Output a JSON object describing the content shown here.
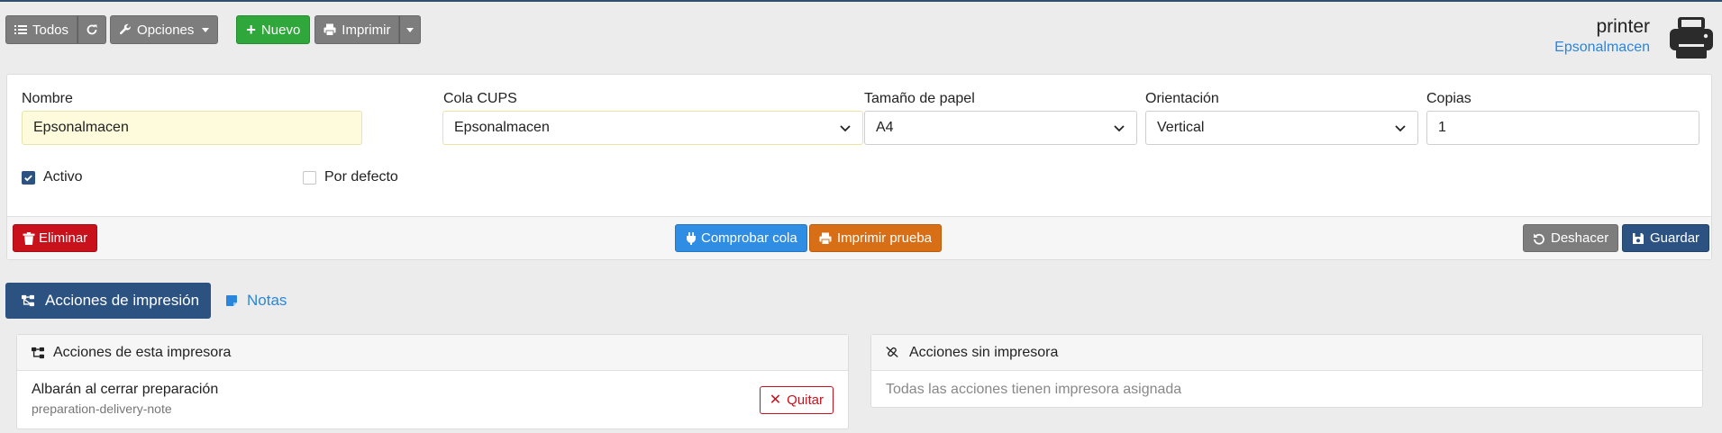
{
  "toolbar": {
    "all_label": "Todos",
    "options_label": "Opciones",
    "new_label": "Nuevo",
    "print_label": "Imprimir"
  },
  "header": {
    "title": "printer",
    "subtitle": "Epsonalmacen"
  },
  "form": {
    "name": {
      "label": "Nombre",
      "value": "Epsonalmacen"
    },
    "cups_queue": {
      "label": "Cola CUPS",
      "value": "Epsonalmacen"
    },
    "paper_size": {
      "label": "Tamaño de papel",
      "value": "A4"
    },
    "orientation": {
      "label": "Orientación",
      "value": "Vertical"
    },
    "copies": {
      "label": "Copias",
      "value": "1"
    },
    "active": {
      "label": "Activo",
      "checked": true
    },
    "default": {
      "label": "Por defecto",
      "checked": false
    }
  },
  "footer": {
    "delete_label": "Eliminar",
    "check_queue_label": "Comprobar cola",
    "test_print_label": "Imprimir prueba",
    "undo_label": "Deshacer",
    "save_label": "Guardar"
  },
  "tabs": [
    {
      "label": "Acciones de impresión",
      "active": true
    },
    {
      "label": "Notas",
      "active": false
    }
  ],
  "panels": {
    "printer_actions": {
      "title": "Acciones de esta impresora",
      "items": [
        {
          "title": "Albarán al cerrar preparación",
          "code": "preparation-delivery-note",
          "remove_label": "Quitar"
        }
      ]
    },
    "unassigned_actions": {
      "title": "Acciones sin impresora",
      "empty_text": "Todas las acciones tienen impresora asignada"
    }
  },
  "colors": {
    "primary": "#2c5282",
    "link": "#2a86dd",
    "success": "#2fa73b",
    "danger": "#c9111c",
    "info": "#2f8de4",
    "warning": "#d86f16",
    "neutral": "#7d7d7d"
  }
}
